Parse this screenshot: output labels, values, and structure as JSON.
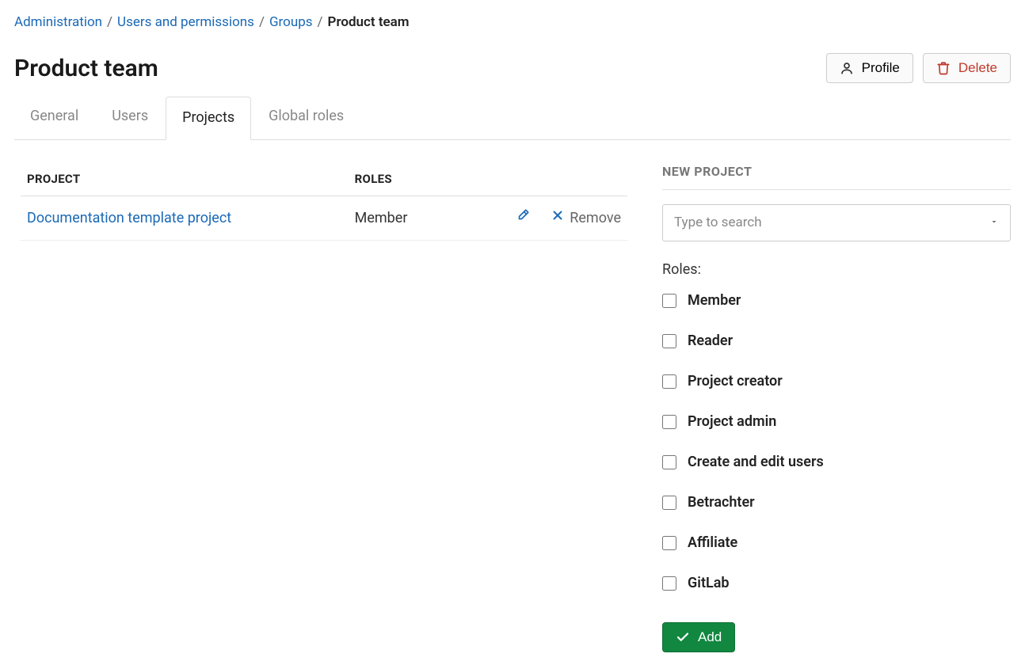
{
  "breadcrumb": {
    "items": [
      {
        "label": "Administration"
      },
      {
        "label": "Users and permissions"
      },
      {
        "label": "Groups"
      }
    ],
    "current": "Product team"
  },
  "page": {
    "title": "Product team"
  },
  "header": {
    "profile_label": "Profile",
    "delete_label": "Delete"
  },
  "tabs": [
    {
      "label": "General",
      "active": false
    },
    {
      "label": "Users",
      "active": false
    },
    {
      "label": "Projects",
      "active": true
    },
    {
      "label": "Global roles",
      "active": false
    }
  ],
  "table": {
    "headers": {
      "project": "PROJECT",
      "roles": "ROLES"
    },
    "rows": [
      {
        "project": "Documentation template project",
        "roles": "Member"
      }
    ],
    "row_actions": {
      "remove": "Remove"
    }
  },
  "sidebar": {
    "title": "NEW PROJECT",
    "search_placeholder": "Type to search",
    "roles_label": "Roles:",
    "roles": [
      "Member",
      "Reader",
      "Project creator",
      "Project admin",
      "Create and edit users",
      "Betrachter",
      "Affiliate",
      "GitLab"
    ],
    "add_label": "Add"
  }
}
